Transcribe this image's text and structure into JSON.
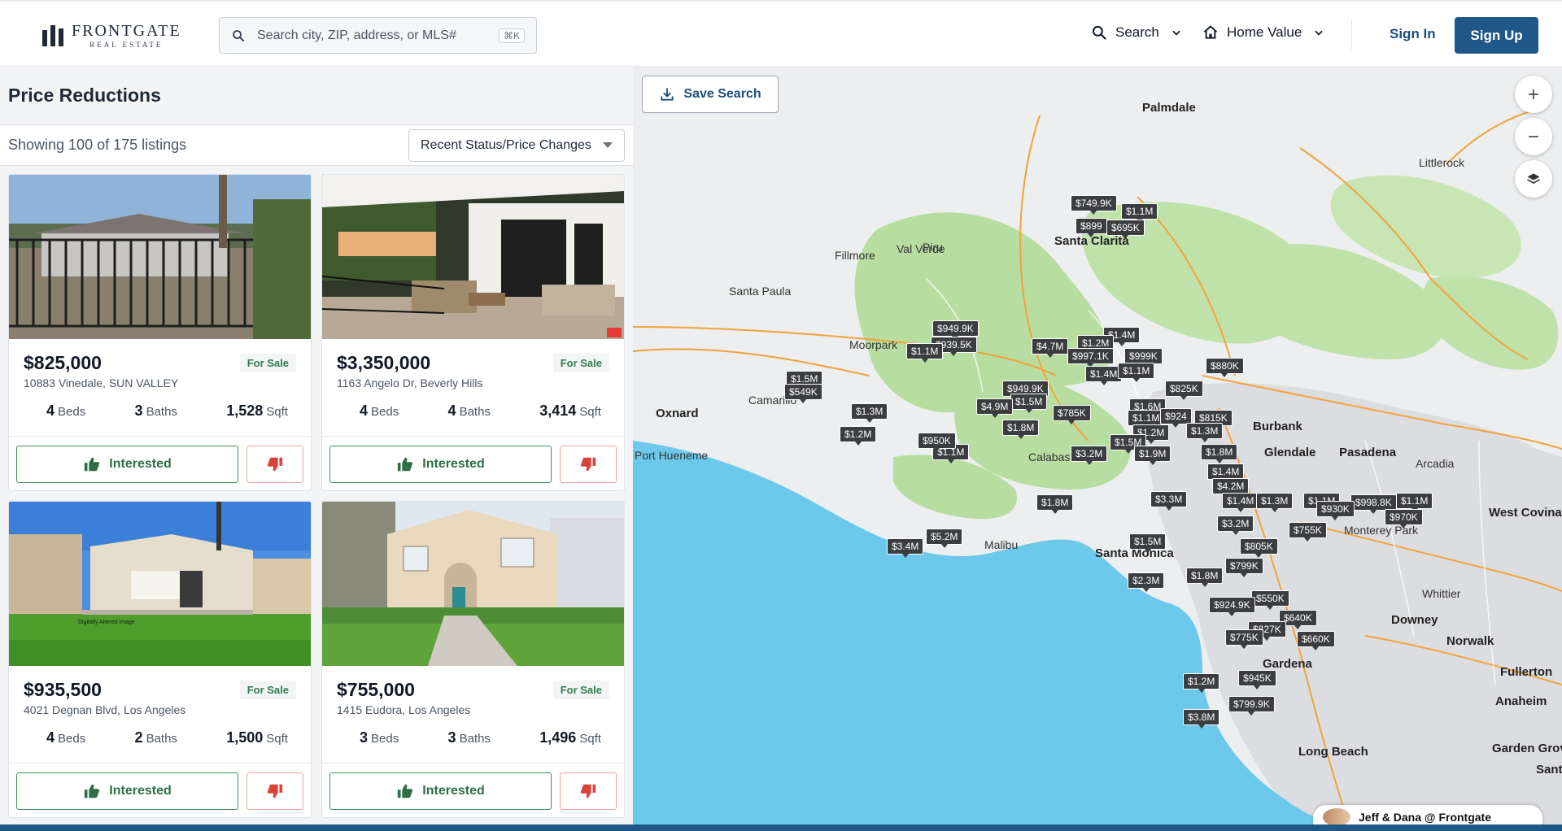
{
  "header": {
    "logo_main": "FRONTGATE",
    "logo_sub": "REAL ESTATE",
    "search_placeholder": "Search city, ZIP, address, or MLS#",
    "search_shortcut": "⌘K",
    "nav_search": "Search",
    "nav_home_value": "Home Value",
    "sign_in": "Sign In",
    "sign_up": "Sign Up"
  },
  "panel": {
    "title": "Price Reductions",
    "count": "Showing 100 of 175 listings",
    "sort": "Recent Status/Price Changes"
  },
  "listings": [
    {
      "price": "$825,000",
      "status": "For Sale",
      "address": "10883 Vinedale, SUN VALLEY",
      "beds": "4",
      "baths": "3",
      "sqft": "1,528",
      "beds_label": "Beds",
      "baths_label": "Baths",
      "sqft_label": "Sqft",
      "interested": "Interested"
    },
    {
      "price": "$3,350,000",
      "status": "For Sale",
      "address": "1163 Angelo Dr, Beverly Hills",
      "beds": "4",
      "baths": "4",
      "sqft": "3,414",
      "beds_label": "Beds",
      "baths_label": "Baths",
      "sqft_label": "Sqft",
      "interested": "Interested"
    },
    {
      "price": "$935,500",
      "status": "For Sale",
      "address": "4021 Degnan Blvd, Los Angeles",
      "beds": "4",
      "baths": "2",
      "sqft": "1,500",
      "beds_label": "Beds",
      "baths_label": "Baths",
      "sqft_label": "Sqft",
      "interested": "Interested",
      "photo_note": "Digitally Altered Image"
    },
    {
      "price": "$755,000",
      "status": "For Sale",
      "address": "1415 Eudora, Los Angeles",
      "beds": "3",
      "baths": "3",
      "sqft": "1,496",
      "beds_label": "Beds",
      "baths_label": "Baths",
      "sqft_label": "Sqft",
      "interested": "Interested"
    }
  ],
  "map": {
    "save_search": "Save Search",
    "agent": "Jeff & Dana @ Frontgate",
    "places": [
      {
        "name": "Palmdale",
        "big": true
      },
      {
        "name": "Littlerock",
        "big": false
      },
      {
        "name": "Val Verde",
        "big": false
      },
      {
        "name": "Santa Clarita",
        "big": true
      },
      {
        "name": "Fillmore",
        "big": false
      },
      {
        "name": "Piru",
        "big": false
      },
      {
        "name": "Santa Paula",
        "big": false
      },
      {
        "name": "Moorpark",
        "big": false
      },
      {
        "name": "Camarillo",
        "big": false
      },
      {
        "name": "Oxnard",
        "big": true
      },
      {
        "name": "Port Hueneme",
        "big": false
      },
      {
        "name": "Calabasas",
        "big": false
      },
      {
        "name": "Burbank",
        "big": true
      },
      {
        "name": "Glendale",
        "big": true
      },
      {
        "name": "Pasadena",
        "big": true
      },
      {
        "name": "Arcadia",
        "big": false
      },
      {
        "name": "West Covina",
        "big": true
      },
      {
        "name": "Monterey Park",
        "big": false
      },
      {
        "name": "Malibu",
        "big": false
      },
      {
        "name": "Santa Monica",
        "big": true
      },
      {
        "name": "Whittier",
        "big": false
      },
      {
        "name": "Downey",
        "big": true
      },
      {
        "name": "Norwalk",
        "big": true
      },
      {
        "name": "Gardena",
        "big": true
      },
      {
        "name": "Fullerton",
        "big": true
      },
      {
        "name": "Anaheim",
        "big": true
      },
      {
        "name": "Long Beach",
        "big": true
      },
      {
        "name": "Garden Grove",
        "big": true
      },
      {
        "name": "Santa Ana",
        "big": true
      }
    ],
    "pins": [
      "$749.9K",
      "$1.1M",
      "$899",
      "$695K",
      "$1.4M",
      "$949.9K",
      "$939.5K",
      "$1.1M",
      "$4.7M",
      "$1.2M",
      "$997.1K",
      "$999K",
      "$1.4M",
      "$1.1M",
      "$880K",
      "$1.5M",
      "$549K",
      "$949.9K",
      "$1.5M",
      "$825K",
      "$4.9M",
      "$785K",
      "$1.6M",
      "$1.1M",
      "$924",
      "$815K",
      "$1.3M",
      "$1.2M",
      "$1.8M",
      "$1.2M",
      "$1.3M",
      "$1.1M",
      "$950K",
      "$1.5M",
      "$3.2M",
      "$1.9M",
      "$1.8M",
      "$1.4M",
      "$4.2M",
      "$1.4M",
      "$1.1M",
      "$998.8K",
      "$1.1M",
      "$930K",
      "$970K",
      "$3.3M",
      "$1.8M",
      "$3.2M",
      "$755K",
      "$1.5M",
      "$805K",
      "$3.4M",
      "$5.2M",
      "$2.3M",
      "$1.8M",
      "$799K",
      "$550K",
      "$924.9K",
      "$640K",
      "$827K",
      "$775K",
      "$660K",
      "$1.2M",
      "$945K",
      "$799.9K",
      "$3.8M",
      "$1.3M"
    ]
  }
}
